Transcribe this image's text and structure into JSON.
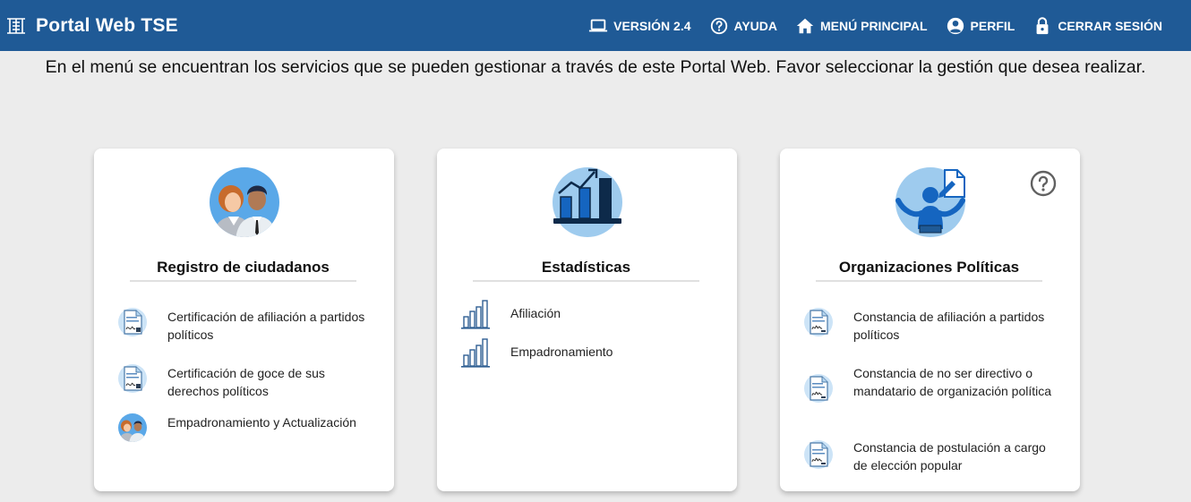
{
  "header": {
    "title": "Portal Web TSE",
    "nav": [
      {
        "label": "VERSIÓN 2.4",
        "icon": "laptop-icon"
      },
      {
        "label": "AYUDA",
        "icon": "help-circle-icon"
      },
      {
        "label": "MENÚ PRINCIPAL",
        "icon": "home-icon"
      },
      {
        "label": "PERFIL",
        "icon": "account-circle-icon"
      },
      {
        "label": "CERRAR SESIÓN",
        "icon": "lock-icon"
      }
    ]
  },
  "intro": "En el menú se encuentran los servicios que se pueden gestionar a través de este Portal Web. Favor seleccionar la gestión que desea realizar.",
  "cards": [
    {
      "title": "Registro de ciudadanos",
      "icon": "citizens-icon",
      "items": [
        {
          "label": "Certificación de afiliación a partidos políticos",
          "icon": "certificate-document-icon"
        },
        {
          "label": "Certificación de goce de sus derechos políticos",
          "icon": "certificate-document-icon"
        },
        {
          "label": "Empadronamiento y Actualización",
          "icon": "citizens-icon"
        }
      ]
    },
    {
      "title": "Estadísticas",
      "icon": "bar-chart-growth-icon",
      "items": [
        {
          "label": "Afiliación",
          "icon": "bar-chart-icon"
        },
        {
          "label": "Empadronamiento",
          "icon": "bar-chart-icon"
        }
      ]
    },
    {
      "title": "Organizaciones Políticas",
      "icon": "political-organization-icon",
      "help_icon": "help-circle-icon",
      "items": [
        {
          "label": "Constancia de afiliación a partidos políticos",
          "icon": "constancia-document-icon"
        },
        {
          "label": "Constancia de no ser directivo o mandatario de organización política",
          "icon": "constancia-document-icon"
        },
        {
          "label": "Constancia de postulación a cargo de elección popular",
          "icon": "constancia-document-icon"
        }
      ]
    }
  ],
  "colors": {
    "header_bg": "#1f5a96",
    "page_bg": "#ececec",
    "card_bg": "#ffffff",
    "icon_blue": "#1565c0",
    "icon_light": "#9ecbee"
  }
}
